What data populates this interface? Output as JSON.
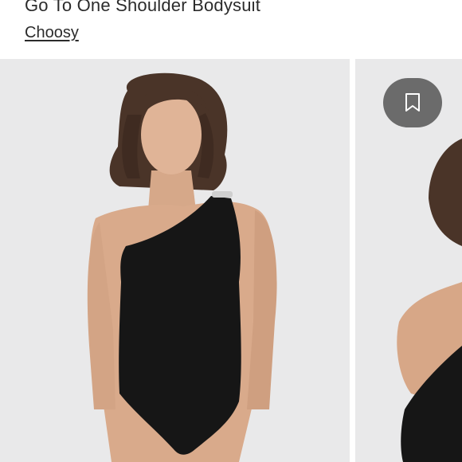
{
  "listing": {
    "title": "Go To One Shoulder Bodysuit",
    "brand": "Choosy"
  },
  "carousel": {
    "images": [
      {
        "alt": "model-front-one-shoulder-bodysuit"
      },
      {
        "alt": "model-side-one-shoulder-bodysuit"
      }
    ],
    "save_icon": "bookmark-icon"
  },
  "colors": {
    "background": "#e9e9ea",
    "garment": "#161616",
    "text": "#2b2b2b"
  }
}
